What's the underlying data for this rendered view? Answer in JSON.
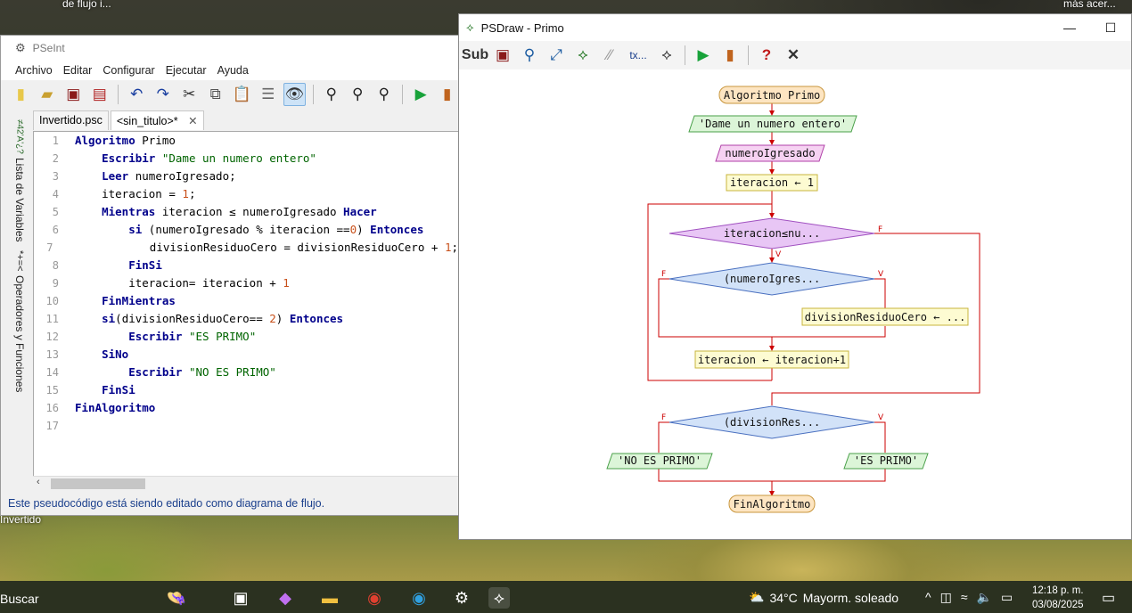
{
  "desktop": {
    "label_top_left": "de flujo i...",
    "label_top_right": "más acer...",
    "label_invertido": "Invertido"
  },
  "pseint": {
    "title": "PSeInt",
    "menu": [
      "Archivo",
      "Editar",
      "Configurar",
      "Ejecutar",
      "Ayuda"
    ],
    "tabs": [
      {
        "label": "Invertido.psc"
      },
      {
        "label": "<sin_titulo>*",
        "close": "✕"
      }
    ],
    "side_labels": [
      "Lista de Variables",
      "Operadores y Funciones"
    ],
    "status": "Este pseudocódigo está siendo editado como diagrama de flujo.",
    "code_lines": [
      {
        "n": "1",
        "html": "<span class='kw'>Algoritmo</span> Primo"
      },
      {
        "n": "2",
        "html": "    <span class='kw'>Escribir</span> <span class='str'>\"Dame un numero entero\"</span>"
      },
      {
        "n": "3",
        "html": "    <span class='kw'>Leer</span> numeroIgresado;"
      },
      {
        "n": "4",
        "html": "    iteracion = <span class='num'>1</span>;"
      },
      {
        "n": "5",
        "html": "    <span class='kw'>Mientras</span> iteracion ≤ numeroIgresado <span class='kw'>Hacer</span>"
      },
      {
        "n": "6",
        "html": "        <span class='kw'>si</span> (numeroIgresado % iteracion ==<span class='num'>0</span>) <span class='kw'>Entonces</span>"
      },
      {
        "n": "7",
        "html": "            divisionResiduoCero = divisionResiduoCero + <span class='num'>1</span>;"
      },
      {
        "n": "8",
        "html": "        <span class='kw'>FinSi</span>"
      },
      {
        "n": "9",
        "html": "        iteracion= iteracion + <span class='num'>1</span>"
      },
      {
        "n": "10",
        "html": "    <span class='kw'>FinMientras</span>"
      },
      {
        "n": "11",
        "html": "    <span class='kw'>si</span>(divisionResiduoCero== <span class='num'>2</span>) <span class='kw'>Entonces</span>"
      },
      {
        "n": "12",
        "html": "        <span class='kw'>Escribir</span> <span class='str'>\"ES PRIMO\"</span>"
      },
      {
        "n": "13",
        "html": "    <span class='kw'>SiNo</span>"
      },
      {
        "n": "14",
        "html": "        <span class='kw'>Escribir</span> <span class='str'>\"NO ES PRIMO\"</span>"
      },
      {
        "n": "15",
        "html": "    <span class='kw'>FinSi</span>"
      },
      {
        "n": "16",
        "html": "<span class='kw'>FinAlgoritmo</span>"
      },
      {
        "n": "17",
        "html": ""
      }
    ]
  },
  "psdraw": {
    "title": "PSDraw - Primo",
    "toolbar_labels": {
      "sub": "Sub",
      "text": "tx..."
    },
    "minimize": "—",
    "maximize": "☐",
    "flow": {
      "start": "Algoritmo Primo",
      "write1": "'Dame un numero entero'",
      "read": "numeroIgresado",
      "assign_iter": "iteracion ← 1",
      "while_cond": "iteracion≤nu...",
      "if1_cond": "(numeroIgres...",
      "assign_div": "divisionResiduoCero ← ...",
      "iter_inc": "iteracion ← iteracion+1",
      "if2_cond": "(divisionRes...",
      "write_no": "'NO ES PRIMO'",
      "write_yes": "'ES PRIMO'",
      "end": "FinAlgoritmo",
      "flag_true": "V",
      "flag_false": "F"
    }
  },
  "taskbar": {
    "search": "Buscar",
    "temp": "34°C",
    "weather": "Mayorm. soleado",
    "time": "12:18 p. m.",
    "date": "03/08/2025"
  }
}
